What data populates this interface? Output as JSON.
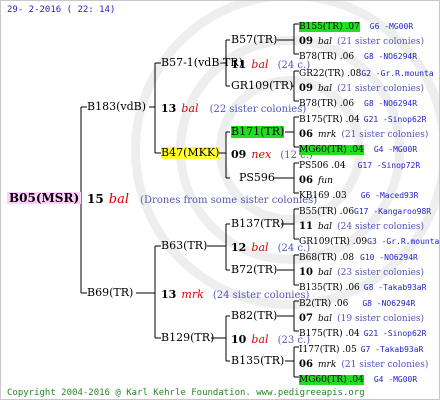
{
  "date": "29- 2-2016 ( 22: 14)",
  "footer": "Copyright 2004-2016 @ Karl Kehrle Foundation.   www.pedigreeapis.org",
  "root": {
    "name": "B05(MSR)",
    "year": "15",
    "queen": "bal",
    "note": "(Drones from some sister colonies)"
  },
  "sire": {
    "name": "B183(vdB)",
    "year": "13",
    "queen": "bal",
    "note": "(22 sister colonies)"
  },
  "dam": {
    "name": "B69(TR)",
    "year": "13",
    "queen": "mrk",
    "note": "(24 sister colonies)"
  },
  "gen3": {
    "b57": {
      "name": "B57-1(vdB-TR)",
      "year": "11",
      "queen": "bal",
      "note": "(24 c.)"
    },
    "b47": {
      "name": "B47(MKK)",
      "year": "09",
      "queen": "nex",
      "note": "(12 c.)"
    },
    "b63": {
      "name": "B63(TR)",
      "year": "12",
      "queen": "bal",
      "note": "(24 c.)"
    },
    "b129": {
      "name": "B129(TR)",
      "year": "10",
      "queen": "bal",
      "note": "(23 c.)"
    }
  },
  "gen4": {
    "b57tr": "B57(TR)",
    "gr109a": "GR109(TR)",
    "b171": "B171(TR)",
    "ps596": "PS596",
    "b137": "B137(TR)",
    "b72": "B72(TR)",
    "b82": "B82(TR)",
    "b135": "B135(TR)"
  },
  "gen5": {
    "g1": {
      "line": "B155(TR) .07",
      "code": "G6 -MG00R"
    },
    "g2": {
      "year": "09",
      "queen": "bal",
      "note": "(21 sister colonies)"
    },
    "g3": {
      "line": "B78(TR) .06",
      "code": "G8 -NO6294R"
    },
    "g4": {
      "line": "GR22(TR) .08",
      "code": "G2 -Gr.R.mounta"
    },
    "g5": {
      "year": "09",
      "queen": "bal",
      "note": "(21 sister colonies)"
    },
    "g6": {
      "line": "B78(TR) .06",
      "code": "G8 -NO6294R"
    },
    "g7": {
      "line": "B175(TR) .04",
      "code": "G21 -Sinop62R"
    },
    "g8": {
      "year": "06",
      "queen": "mrk",
      "note": "(21 sister colonies)"
    },
    "g9": {
      "line": "MG60(TR) .04",
      "code": "G4 -MG00R"
    },
    "g10": {
      "line": "PS506 .04",
      "code": "G17 -Sinop72R"
    },
    "g11": {
      "year": "06",
      "queen": "fun",
      "note": ""
    },
    "g12": {
      "line": "KB169 .03",
      "code": "G6 -Maced93R"
    },
    "g13": {
      "line": "B55(TR) .06",
      "code": "G17 -Kangaroo98R"
    },
    "g14": {
      "year": "11",
      "queen": "bal",
      "note": "(24 sister colonies)"
    },
    "g15": {
      "line": "GR109(TR) .09",
      "code": "G3 -Gr.R.mounta"
    },
    "g16": {
      "line": "B68(TR) .08",
      "code": "G10 -NO6294R"
    },
    "g17": {
      "year": "10",
      "queen": "bal",
      "note": "(23 sister colonies)"
    },
    "g18": {
      "line": "B135(TR) .06",
      "code": "G8 -Takab93aR"
    },
    "g19": {
      "line": "B2(TR) .06",
      "code": "G8 -NO6294R"
    },
    "g20": {
      "year": "07",
      "queen": "bal",
      "note": "(19 sister colonies)"
    },
    "g21": {
      "line": "B175(TR) .04",
      "code": "G21 -Sinop62R"
    },
    "g22": {
      "line": "I177(TR) .05",
      "code": "G7 -Takab93aR"
    },
    "g23": {
      "year": "06",
      "queen": "mrk",
      "note": "(21 sister colonies)"
    },
    "g24": {
      "line": "MG60(TR) .04",
      "code": "G4 -MG00R"
    }
  }
}
